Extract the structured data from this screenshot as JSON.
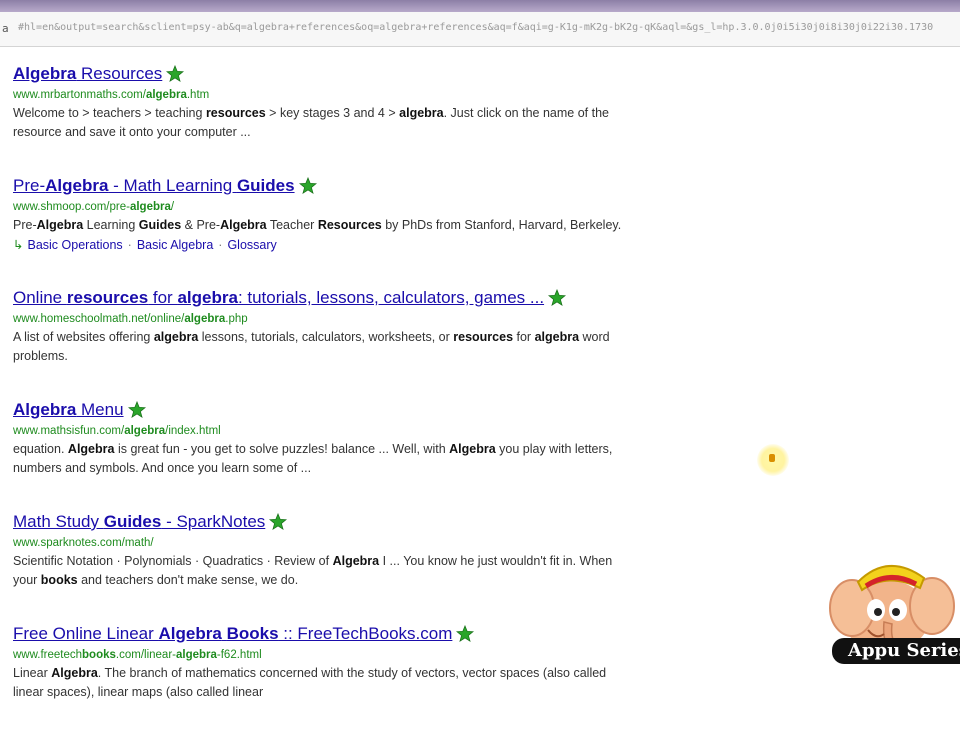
{
  "browser": {
    "url_prefix": "a",
    "url_text": "#hl=en&output=search&sclient=psy-ab&q=algebra+references&oq=algebra+references&aq=f&aqi=g-K1g-mK2g-bK2g-qK&aql=&gs_l=hp.3.0.0j0i5i30j0i8i30j0i22i30.1730"
  },
  "results": [
    {
      "title": [
        {
          "t": "Algebra",
          "b": true
        },
        {
          "t": " Resources",
          "b": false
        }
      ],
      "cite": [
        {
          "t": "www.mrbartonmaths.com/",
          "b": false
        },
        {
          "t": "algebra",
          "b": true
        },
        {
          "t": ".htm",
          "b": false
        }
      ],
      "snippet": [
        {
          "t": "Welcome to > teachers > teaching ",
          "b": false
        },
        {
          "t": "resources",
          "b": true
        },
        {
          "t": " > key stages 3 and 4 > ",
          "b": false
        },
        {
          "t": "algebra",
          "b": true
        },
        {
          "t": ". Just click on the name of the resource and save it onto your computer ...",
          "b": false
        }
      ]
    },
    {
      "title": [
        {
          "t": "Pre-",
          "b": false
        },
        {
          "t": "Algebra",
          "b": true
        },
        {
          "t": " - Math Learning ",
          "b": false
        },
        {
          "t": "Guides",
          "b": true
        }
      ],
      "cite": [
        {
          "t": "www.shmoop.com/pre-",
          "b": false
        },
        {
          "t": "algebra",
          "b": true
        },
        {
          "t": "/",
          "b": false
        }
      ],
      "snippet": [
        {
          "t": "Pre-",
          "b": false
        },
        {
          "t": "Algebra",
          "b": true
        },
        {
          "t": " Learning ",
          "b": false
        },
        {
          "t": "Guides",
          "b": true
        },
        {
          "t": " & Pre-",
          "b": false
        },
        {
          "t": "Algebra",
          "b": true
        },
        {
          "t": " Teacher ",
          "b": false
        },
        {
          "t": "Resources",
          "b": true
        },
        {
          "t": " by PhDs from Stanford, Harvard, Berkeley.",
          "b": false
        }
      ],
      "sitelinks": [
        "Basic Operations",
        "Basic Algebra",
        "Glossary"
      ],
      "sitelinks_arrow": "↳"
    },
    {
      "title": [
        {
          "t": "Online ",
          "b": false
        },
        {
          "t": "resources",
          "b": true
        },
        {
          "t": " for ",
          "b": false
        },
        {
          "t": "algebra",
          "b": true
        },
        {
          "t": ": tutorials, lessons, calculators, games ...",
          "b": false
        }
      ],
      "cite": [
        {
          "t": "www.homeschoolmath.net/online/",
          "b": false
        },
        {
          "t": "algebra",
          "b": true
        },
        {
          "t": ".php",
          "b": false
        }
      ],
      "snippet": [
        {
          "t": "A list of websites offering ",
          "b": false
        },
        {
          "t": "algebra",
          "b": true
        },
        {
          "t": " lessons, tutorials, calculators, worksheets, or ",
          "b": false
        },
        {
          "t": "resources",
          "b": true
        },
        {
          "t": " for ",
          "b": false
        },
        {
          "t": "algebra",
          "b": true
        },
        {
          "t": " word problems.",
          "b": false
        }
      ]
    },
    {
      "title": [
        {
          "t": "Algebra",
          "b": true
        },
        {
          "t": " Menu",
          "b": false
        }
      ],
      "cite": [
        {
          "t": "www.mathsisfun.com/",
          "b": false
        },
        {
          "t": "algebra",
          "b": true
        },
        {
          "t": "/index.html",
          "b": false
        }
      ],
      "snippet": [
        {
          "t": "equation. ",
          "b": false
        },
        {
          "t": "Algebra",
          "b": true
        },
        {
          "t": " is great fun - you get to solve puzzles! balance ... Well, with ",
          "b": false
        },
        {
          "t": "Algebra",
          "b": true
        },
        {
          "t": " you play with letters, numbers and symbols. And once you learn some of ...",
          "b": false
        }
      ]
    },
    {
      "title": [
        {
          "t": "Math Study ",
          "b": false
        },
        {
          "t": "Guides",
          "b": true
        },
        {
          "t": " - SparkNotes",
          "b": false
        }
      ],
      "cite": [
        {
          "t": "www.sparknotes.com/math/",
          "b": false
        }
      ],
      "snippet": [
        {
          "t": "Scientific Notation · Polynomials · Quadratics · Review of ",
          "b": false
        },
        {
          "t": "Algebra",
          "b": true
        },
        {
          "t": " I ... You know he just wouldn't fit in. When your ",
          "b": false
        },
        {
          "t": "books",
          "b": true
        },
        {
          "t": " and teachers don't make sense, we do.",
          "b": false
        }
      ]
    },
    {
      "title": [
        {
          "t": "Free Online Linear ",
          "b": false
        },
        {
          "t": "Algebra",
          "b": true
        },
        {
          "t": " ",
          "b": false
        },
        {
          "t": "Books",
          "b": true
        },
        {
          "t": " :: FreeTechBooks.com",
          "b": false
        }
      ],
      "cite": [
        {
          "t": "www.freetech",
          "b": false
        },
        {
          "t": "books",
          "b": true
        },
        {
          "t": ".com/linear-",
          "b": false
        },
        {
          "t": "algebra",
          "b": true
        },
        {
          "t": "-f62.html",
          "b": false
        }
      ],
      "snippet": [
        {
          "t": "Linear ",
          "b": false
        },
        {
          "t": "Algebra",
          "b": true
        },
        {
          "t": ". The branch of mathematics concerned with the study of vectors, vector spaces (also called linear spaces), linear maps (also called linear",
          "b": false
        }
      ]
    }
  ],
  "watermark": {
    "label": "Appu Series"
  },
  "colors": {
    "link": "#1a0dab",
    "cite": "#1e8b1e",
    "star": "#2aa52a"
  },
  "icons": {
    "preview": "magnifier-star-icon",
    "cursor": "cursor-highlight-icon",
    "mascot": "elephant-mascot-icon"
  }
}
